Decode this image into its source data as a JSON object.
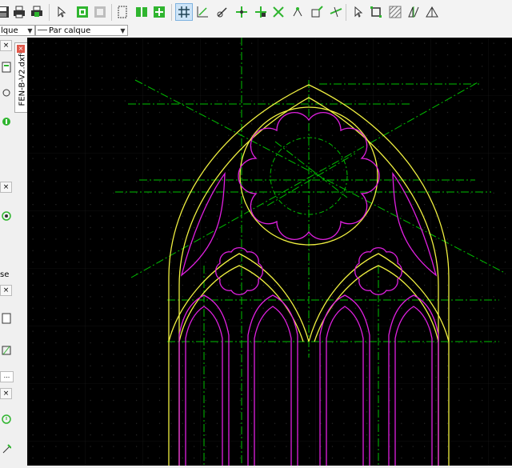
{
  "toolbar": {
    "icons": [
      "save-icon",
      "print-icon",
      "print-preview-icon",
      "select-pointer-icon",
      "layer-on-icon",
      "layer-off-icon",
      "block-icon",
      "book-icon",
      "insert-icon",
      "grid-icon",
      "snap-icon",
      "draw-icon",
      "move-icon",
      "move-copy-icon",
      "scale-icon",
      "rotate-icon",
      "zoom-window-icon",
      "trim-icon",
      "pointer-icon",
      "fit-icon",
      "hatch-icon",
      "mirror-icon",
      "triangle-icon"
    ]
  },
  "properties": {
    "layer_combo": "lque",
    "style_combo": "Par calque"
  },
  "document": {
    "tab_title": "FEN-B-V2.dxf*",
    "close": "×"
  },
  "dock": {
    "close": "×",
    "label_se": "se",
    "label_ellipsis": "..."
  },
  "colors": {
    "background": "#000000",
    "grid": "#3c3c3c",
    "construction": "#00c000",
    "frame": "#f0f040",
    "tracery": "#e020e0"
  }
}
